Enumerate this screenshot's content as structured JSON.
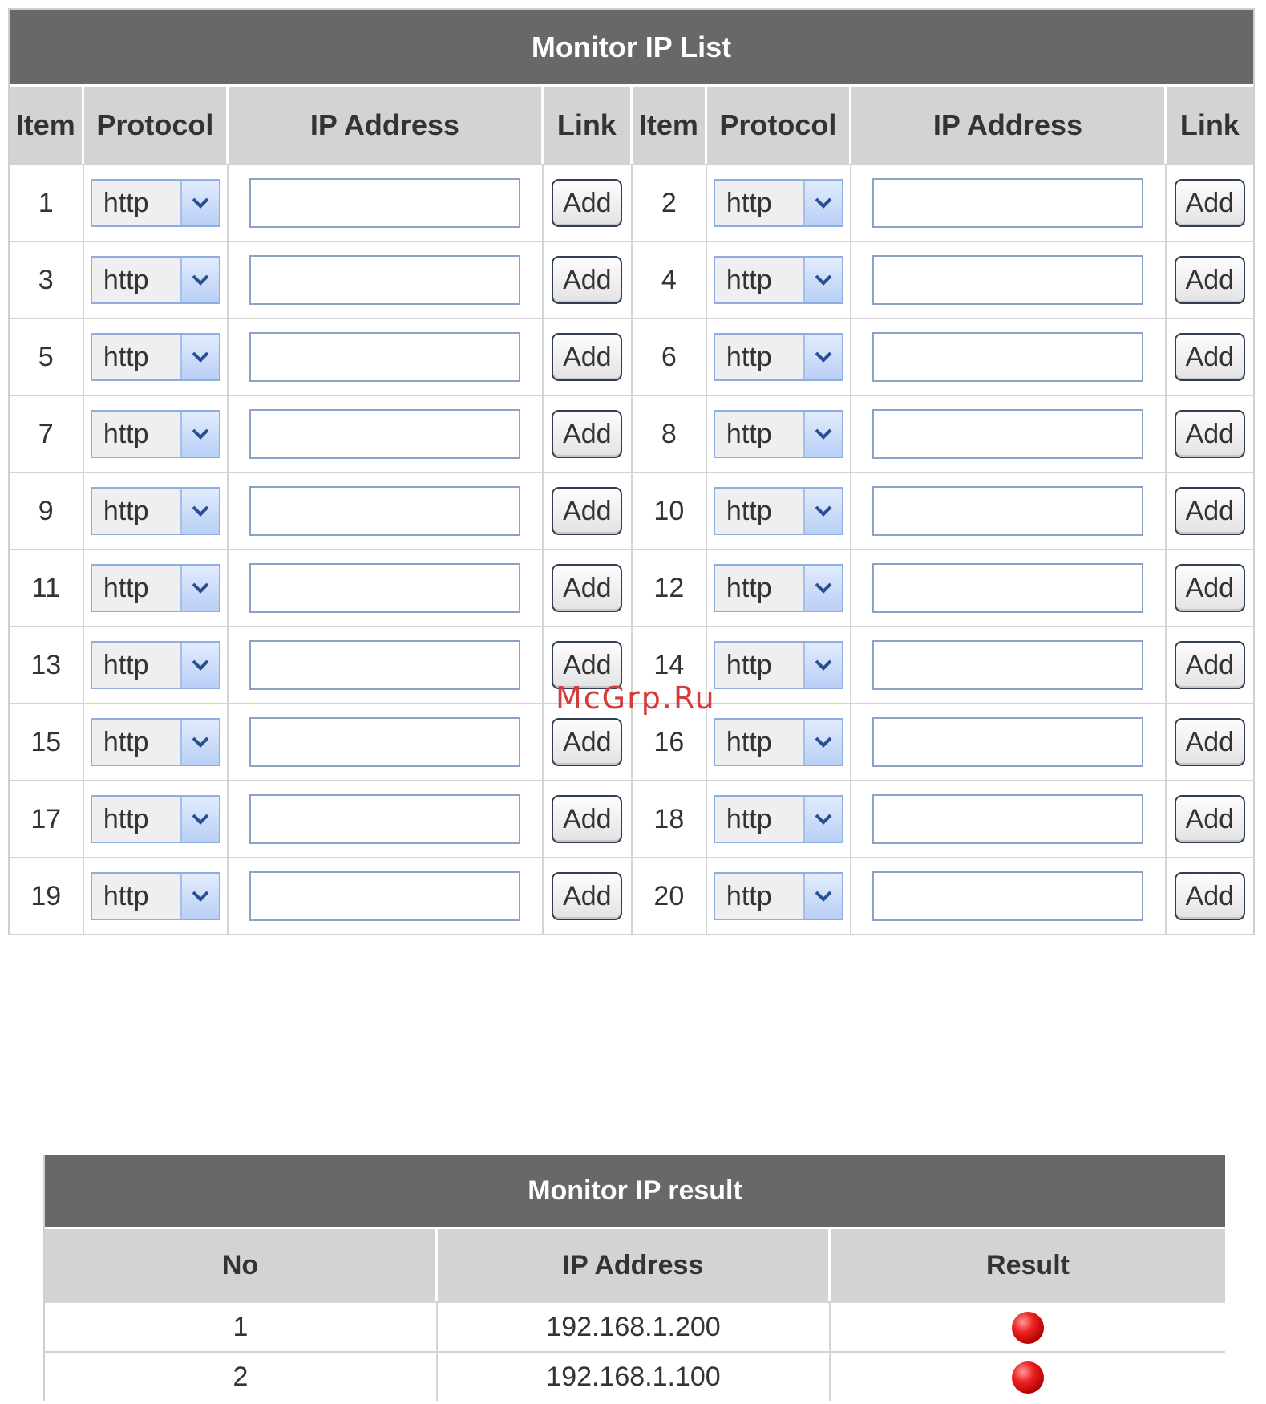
{
  "monitor_list": {
    "title": "Monitor IP List",
    "columns": [
      "Item",
      "Protocol",
      "IP Address",
      "Link",
      "Item",
      "Protocol",
      "IP Address",
      "Link"
    ],
    "protocol_default": "http",
    "add_label": "Add",
    "rows": [
      {
        "left": {
          "item": "1",
          "protocol": "http",
          "ip": ""
        },
        "right": {
          "item": "2",
          "protocol": "http",
          "ip": ""
        }
      },
      {
        "left": {
          "item": "3",
          "protocol": "http",
          "ip": ""
        },
        "right": {
          "item": "4",
          "protocol": "http",
          "ip": ""
        }
      },
      {
        "left": {
          "item": "5",
          "protocol": "http",
          "ip": ""
        },
        "right": {
          "item": "6",
          "protocol": "http",
          "ip": ""
        }
      },
      {
        "left": {
          "item": "7",
          "protocol": "http",
          "ip": ""
        },
        "right": {
          "item": "8",
          "protocol": "http",
          "ip": ""
        }
      },
      {
        "left": {
          "item": "9",
          "protocol": "http",
          "ip": ""
        },
        "right": {
          "item": "10",
          "protocol": "http",
          "ip": ""
        }
      },
      {
        "left": {
          "item": "11",
          "protocol": "http",
          "ip": ""
        },
        "right": {
          "item": "12",
          "protocol": "http",
          "ip": ""
        }
      },
      {
        "left": {
          "item": "13",
          "protocol": "http",
          "ip": ""
        },
        "right": {
          "item": "14",
          "protocol": "http",
          "ip": ""
        }
      },
      {
        "left": {
          "item": "15",
          "protocol": "http",
          "ip": ""
        },
        "right": {
          "item": "16",
          "protocol": "http",
          "ip": ""
        }
      },
      {
        "left": {
          "item": "17",
          "protocol": "http",
          "ip": ""
        },
        "right": {
          "item": "18",
          "protocol": "http",
          "ip": ""
        }
      },
      {
        "left": {
          "item": "19",
          "protocol": "http",
          "ip": ""
        },
        "right": {
          "item": "20",
          "protocol": "http",
          "ip": ""
        }
      }
    ]
  },
  "watermark": "McGrp.Ru",
  "monitor_result": {
    "title": "Monitor IP result",
    "columns": [
      "No",
      "IP Address",
      "Result"
    ],
    "rows": [
      {
        "no": "1",
        "ip": "192.168.1.200",
        "result_icon": "red-status-dot"
      },
      {
        "no": "2",
        "ip": "192.168.1.100",
        "result_icon": "red-status-dot"
      }
    ]
  },
  "colors": {
    "header_dark": "#686868",
    "header_light": "#d3d3d3",
    "status_red": "#e01a1a",
    "select_border": "#8eaee0"
  }
}
